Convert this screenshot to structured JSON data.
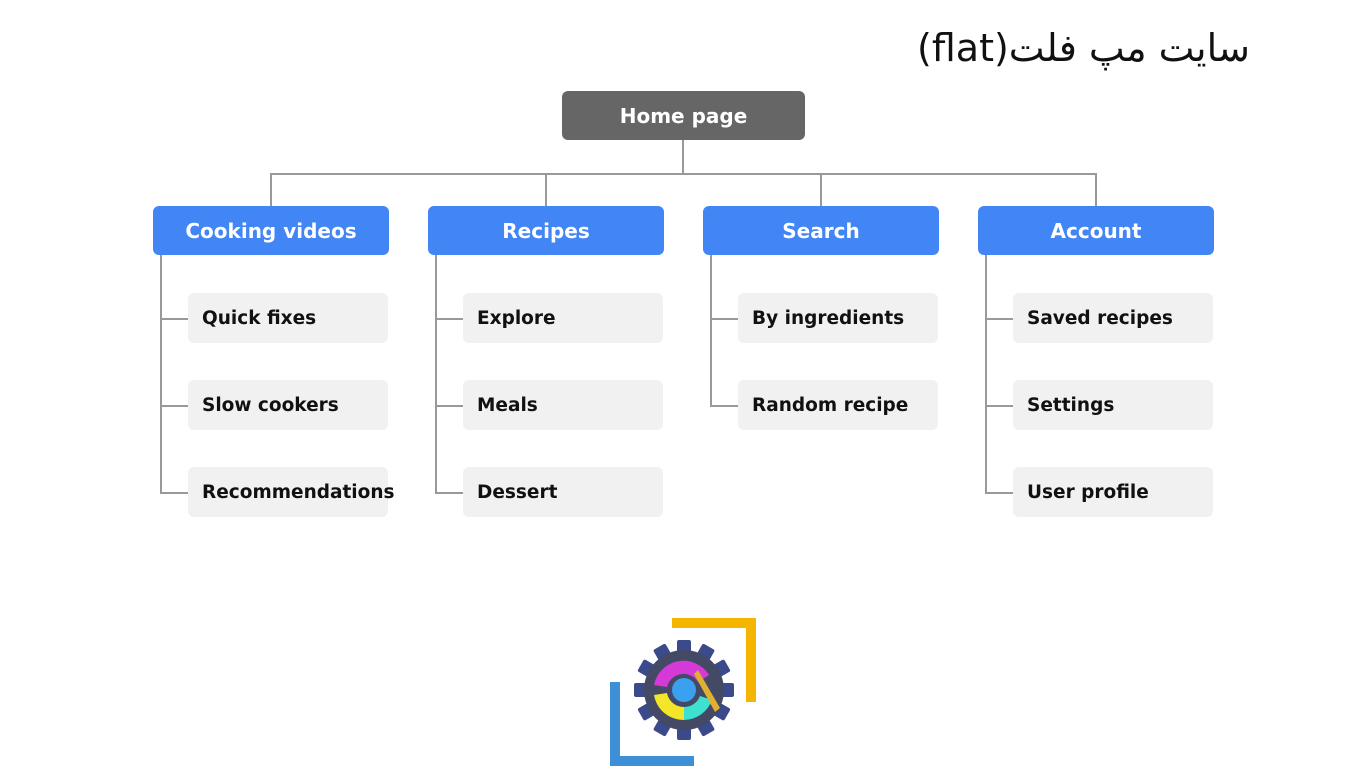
{
  "title": "سایت مپ فلت(flat)",
  "root": {
    "label": "Home page"
  },
  "sections": [
    {
      "label": "Cooking videos",
      "children": [
        "Quick fixes",
        "Slow cookers",
        "Recommendations"
      ]
    },
    {
      "label": "Recipes",
      "children": [
        "Explore",
        "Meals",
        "Dessert"
      ]
    },
    {
      "label": "Search",
      "children": [
        "By ingredients",
        "Random recipe"
      ]
    },
    {
      "label": "Account",
      "children": [
        "Saved recipes",
        "Settings",
        "User profile"
      ]
    }
  ],
  "colors": {
    "root": "#666666",
    "section": "#4285f4",
    "child": "#f1f1f1",
    "connector": "#999999"
  },
  "logo": {
    "icon": "gear-wrench-logo"
  }
}
